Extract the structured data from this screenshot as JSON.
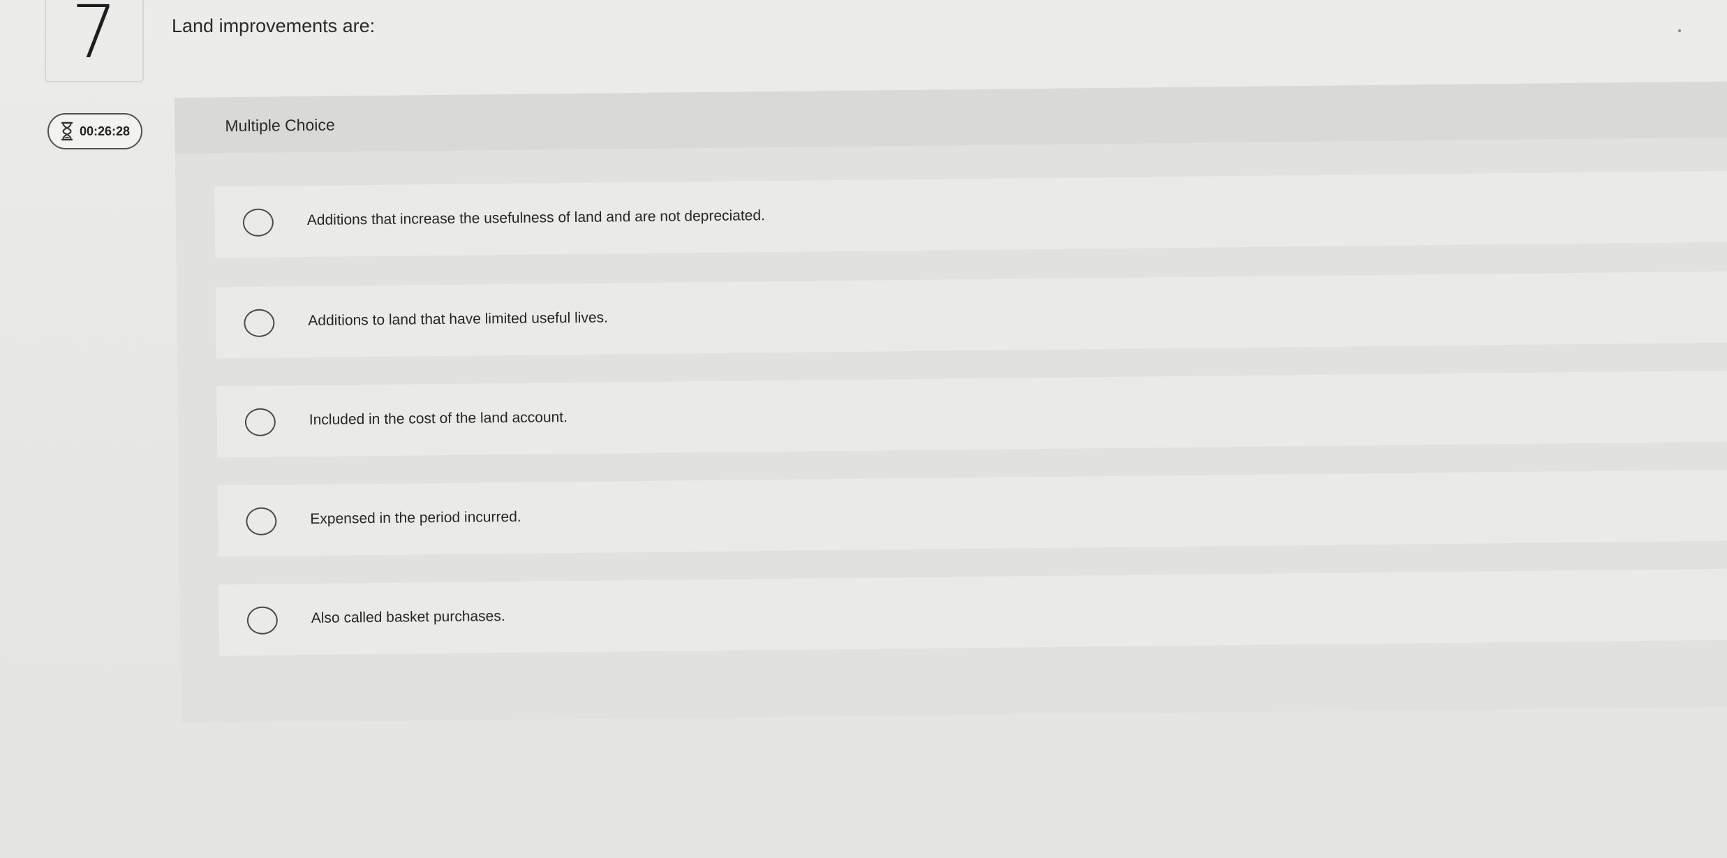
{
  "question": {
    "number": "7",
    "prompt": "Land improvements are:"
  },
  "timer": {
    "icon": "hourglass-icon",
    "value": "00:26:28"
  },
  "panel": {
    "type_label": "Multiple Choice"
  },
  "options": [
    {
      "label": "Additions that increase the usefulness of land and are not depreciated.",
      "selected": false
    },
    {
      "label": "Additions to land that have limited useful lives.",
      "selected": false
    },
    {
      "label": "Included in the cost of the land account.",
      "selected": false
    },
    {
      "label": "Expensed in the period incurred.",
      "selected": false
    },
    {
      "label": "Also called basket purchases.",
      "selected": false
    }
  ],
  "colors": {
    "background": "#e8e8e6",
    "panel": "#e1e1df",
    "panel_header": "#d9d9d7",
    "option_row": "#eaeae8",
    "radio_border": "#4a4a4a",
    "timer_border": "#505050"
  }
}
